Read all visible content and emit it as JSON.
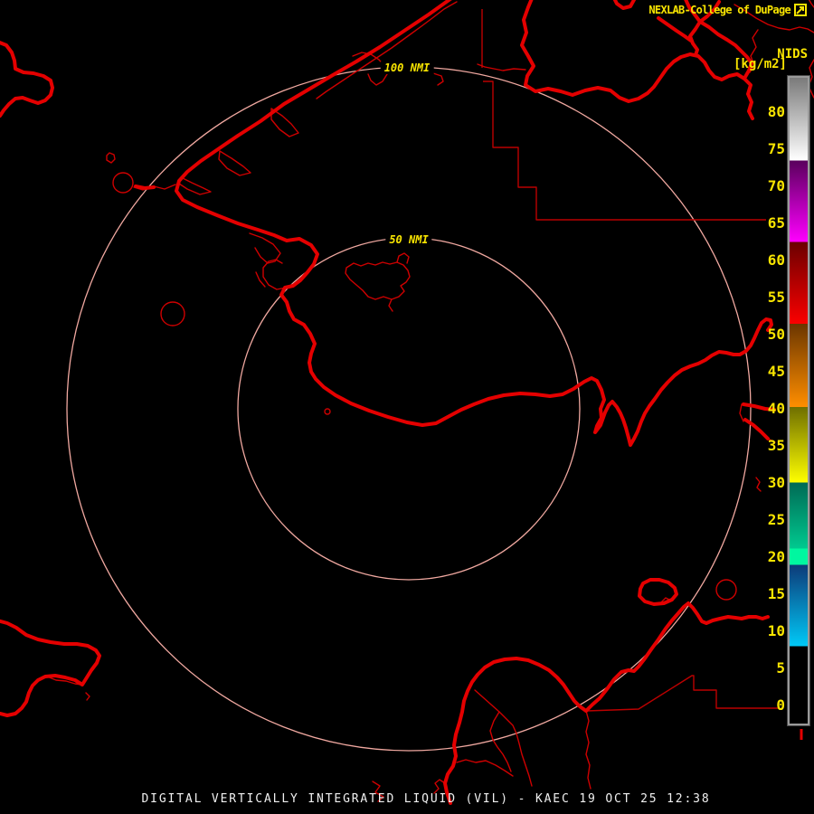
{
  "header": {
    "brand": "NEXLAB-College of DuPage",
    "brand_icon": "external-link-icon"
  },
  "colorbar": {
    "title": "NIDS",
    "units": "[kg/m2]",
    "tick_values": [
      80,
      75,
      70,
      65,
      60,
      55,
      50,
      45,
      40,
      35,
      30,
      25,
      20,
      15,
      10,
      5,
      0
    ],
    "palette": [
      {
        "from": 84.6,
        "to": 73.5,
        "colors": [
          "#7a7a7a",
          "#ffffff"
        ]
      },
      {
        "from": 73.5,
        "to": 62.5,
        "colors": [
          "#59005c",
          "#ff00ff"
        ]
      },
      {
        "from": 62.5,
        "to": 51.5,
        "colors": [
          "#6b0000",
          "#fb0000"
        ]
      },
      {
        "from": 51.5,
        "to": 40.2,
        "colors": [
          "#6b3600",
          "#ff8e00"
        ]
      },
      {
        "from": 40.2,
        "to": 30.0,
        "colors": [
          "#6f6f00",
          "#ffff00"
        ]
      },
      {
        "from": 30.0,
        "to": 21.2,
        "colors": [
          "#006a55",
          "#00c98f"
        ]
      },
      {
        "from": 21.2,
        "to": 19.0,
        "colors": [
          "#00f7a0",
          "#00f7a0"
        ]
      },
      {
        "from": 19.0,
        "to": 8.0,
        "colors": [
          "#0d3a78",
          "#00c9f7"
        ]
      },
      {
        "from": 8.0,
        "to": -3.0,
        "colors": [
          "#000000",
          "#000000"
        ]
      }
    ]
  },
  "range_rings": {
    "outer_label": "100 NMI",
    "inner_label": "50 NMI"
  },
  "status_bar": {
    "caption": "DIGITAL VERTICALLY INTEGRATED LIQUID (VIL) - KAEC 19 OCT 25 12:38"
  },
  "colors": {
    "background": "#000000",
    "coastline_red": "#e40000",
    "boundary_red": "#bb0000",
    "range_ring_salmon": "#f0a8a0",
    "label_yellow": "#f8e400",
    "caption_white": "#f0f0f0"
  }
}
